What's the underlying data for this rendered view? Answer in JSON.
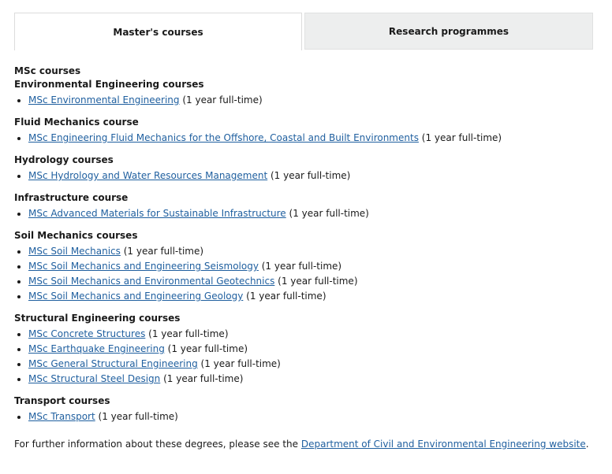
{
  "tabs": {
    "masters": "Master's courses",
    "research": "Research programmes"
  },
  "main_heading": "MSc courses",
  "groups": [
    {
      "heading": "Environmental Engineering courses",
      "items": [
        {
          "link": "MSc Environmental Engineering",
          "suffix": " (1 year full-time)"
        }
      ]
    },
    {
      "heading": "Fluid Mechanics course",
      "items": [
        {
          "link": "MSc Engineering Fluid Mechanics for the Offshore, Coastal and Built Environments",
          "suffix": " (1 year full-time)"
        }
      ]
    },
    {
      "heading": "Hydrology courses",
      "items": [
        {
          "link": "MSc Hydrology and Water Resources Management",
          "suffix": " (1 year full-time)"
        }
      ]
    },
    {
      "heading": "Infrastructure course",
      "items": [
        {
          "link": "MSc Advanced Materials for Sustainable Infrastructure",
          "suffix": " (1 year full-time)"
        }
      ]
    },
    {
      "heading": "Soil Mechanics courses",
      "items": [
        {
          "link": "MSc Soil Mechanics",
          "suffix": " (1 year full-time)"
        },
        {
          "link": "MSc Soil Mechanics and Engineering Seismology",
          "suffix": " (1 year full-time)"
        },
        {
          "link": "MSc Soil Mechanics and Environmental Geotechnics",
          "suffix": " (1 year full-time)"
        },
        {
          "link": "MSc Soil Mechanics and Engineering Geology",
          "suffix": " (1 year full-time)"
        }
      ]
    },
    {
      "heading": "Structural Engineering courses",
      "items": [
        {
          "link": "MSc Concrete Structures",
          "suffix": " (1 year full-time)"
        },
        {
          "link": "MSc Earthquake Engineering",
          "suffix": " (1 year full-time)"
        },
        {
          "link": "MSc General Structural Engineering",
          "suffix": " (1 year full-time)"
        },
        {
          "link": "MSc Structural Steel Design",
          "suffix": " (1 year full-time)"
        }
      ]
    },
    {
      "heading": "Transport courses",
      "items": [
        {
          "link": "MSc Transport",
          "suffix": " (1 year full-time)"
        }
      ]
    }
  ],
  "footer": {
    "prefix": "For further information about these degrees, please see the ",
    "link": "Department of Civil and Environmental Engineering website",
    "suffix": "."
  },
  "colors": {
    "link": "#1f5f9f",
    "inactive_tab_bg": "#edeeee"
  }
}
